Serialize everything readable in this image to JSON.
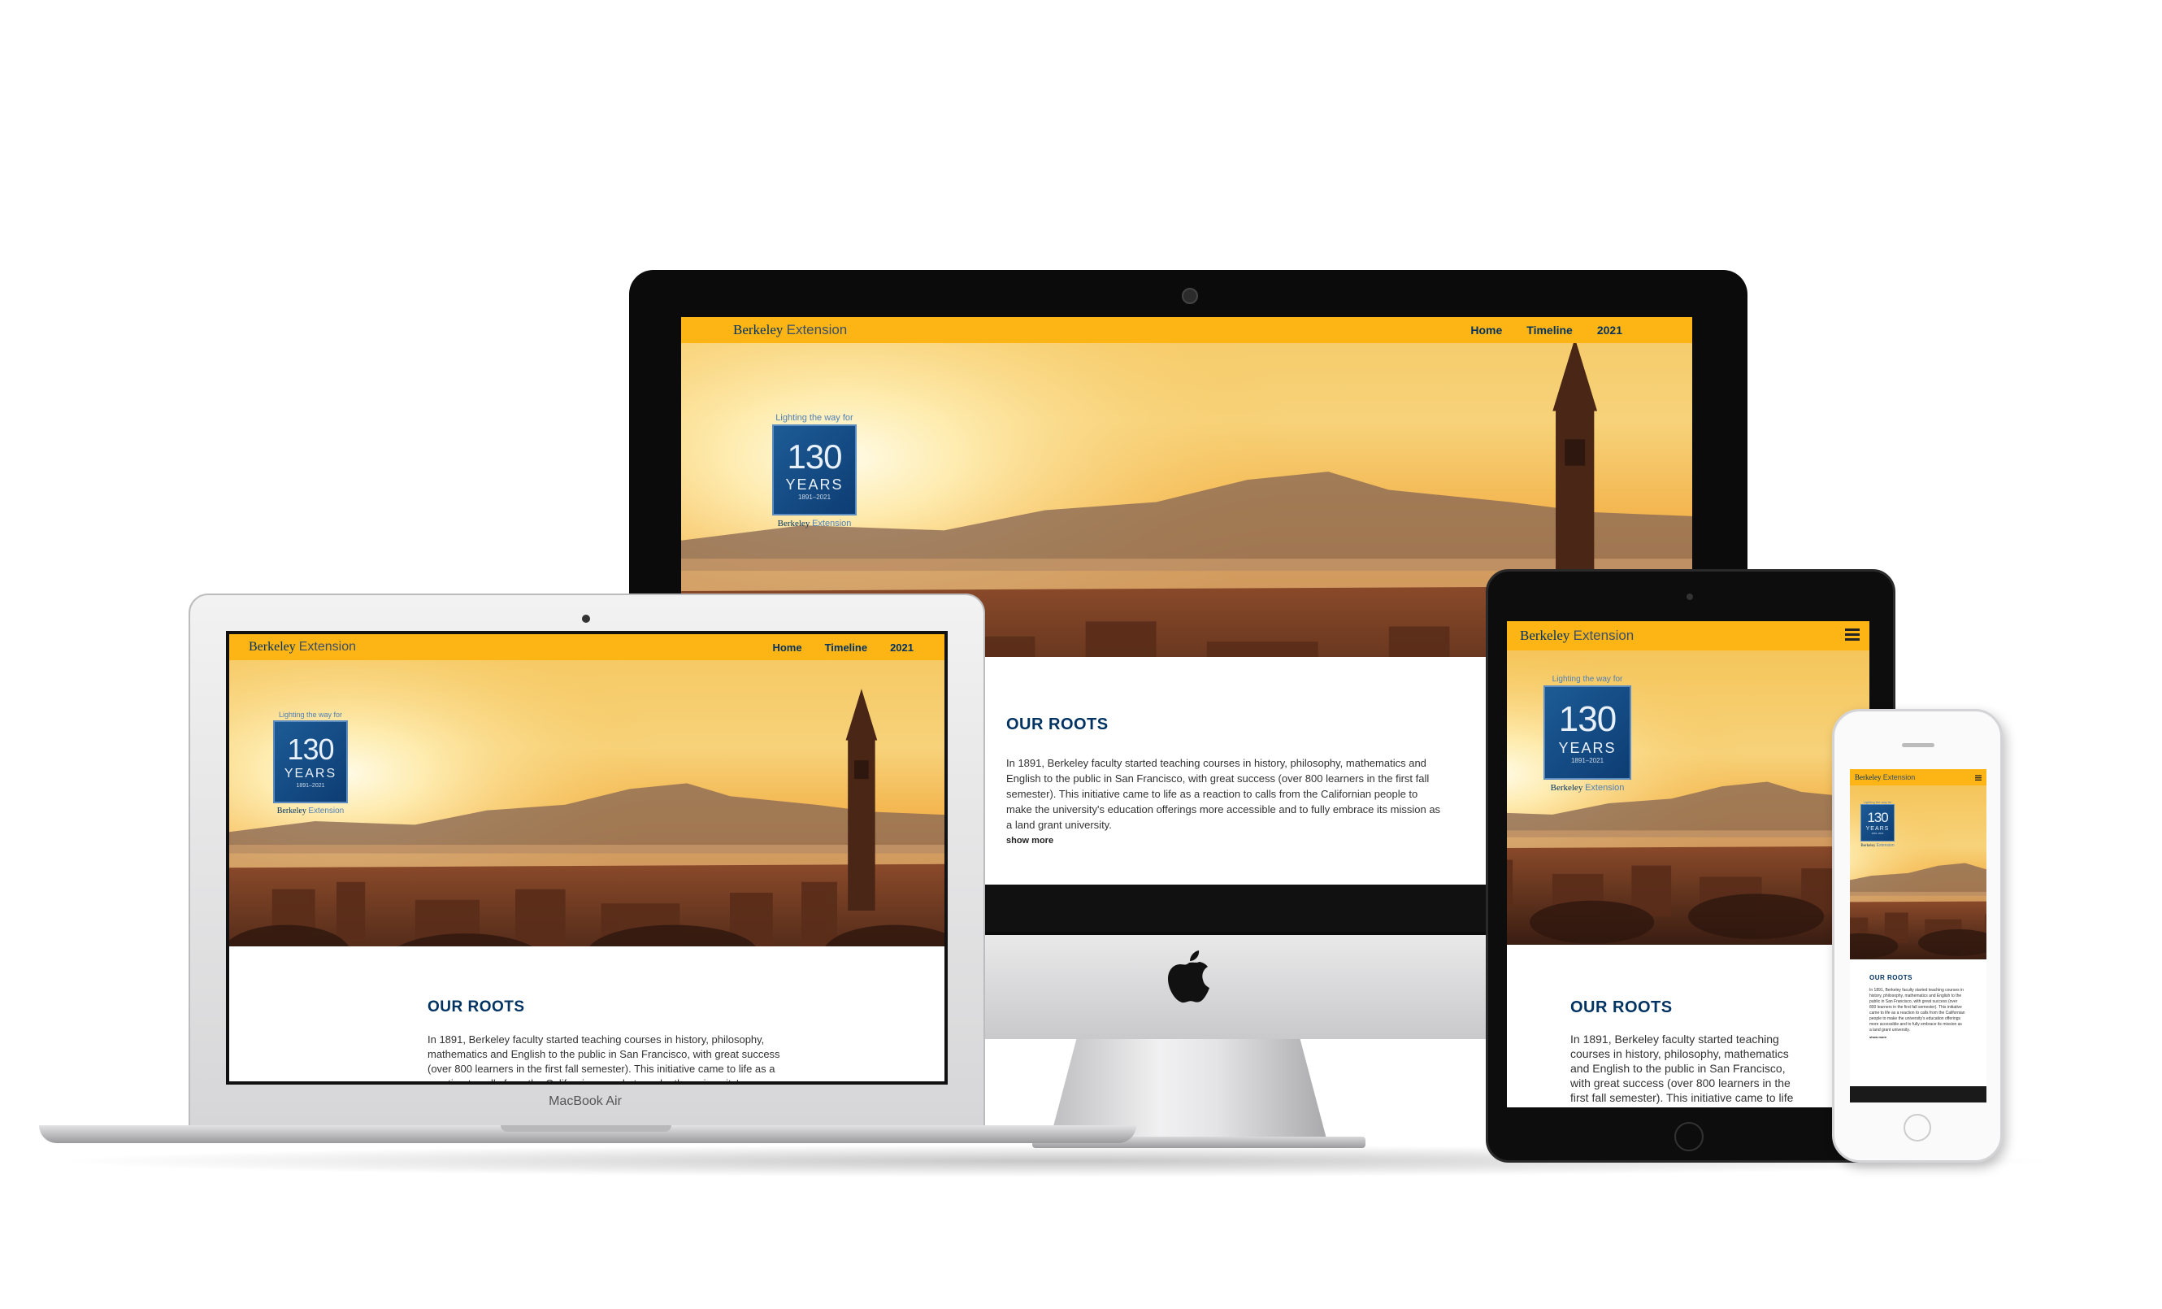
{
  "site": {
    "brand": "Berkeley",
    "brand_ext": "Extension",
    "nav": [
      "Home",
      "Timeline",
      "2021"
    ]
  },
  "badge": {
    "tagline": "Lighting the way for",
    "number": "130",
    "years": "YEARS",
    "range": "1891–2021",
    "brand": "Berkeley",
    "brand_ext": "Extension"
  },
  "section": {
    "heading": "OUR ROOTS",
    "body": "In 1891, Berkeley faculty started teaching courses in history, philosophy, mathematics and English to the public in San Francisco, with great success (over 800 learners in the first fall semester). This initiative came to life as a reaction to calls from the Californian people to make the university's education offerings more accessible and to fully embrace its mission as a land grant university.",
    "show_more": "show more"
  },
  "devices": {
    "laptop_label": "MacBook Air"
  },
  "colors": {
    "gold": "#fdb515",
    "navy": "#003262"
  }
}
